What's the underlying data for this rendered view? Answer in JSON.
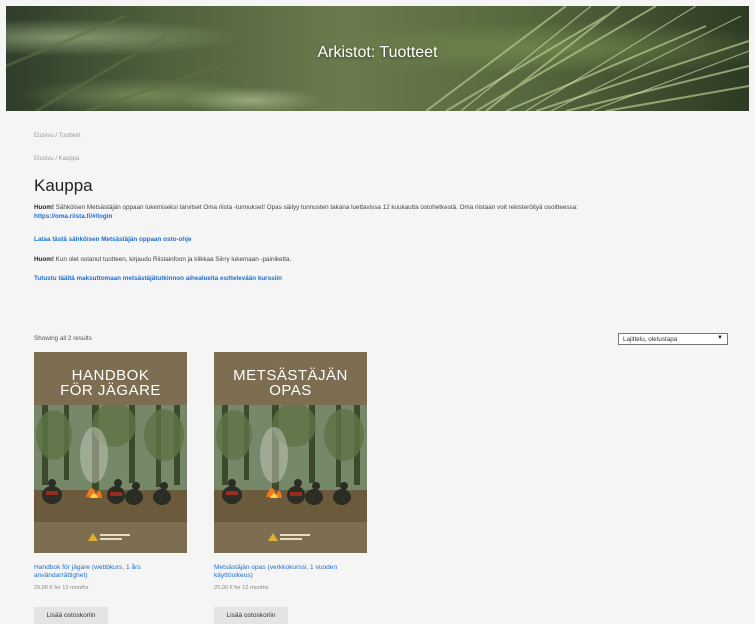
{
  "hero": {
    "title": "Arkistot: Tuotteet"
  },
  "breadcrumbs": {
    "primary": "Etusivu / Tuotteet",
    "secondary": "Etusivu / Kauppa"
  },
  "page": {
    "title": "Kauppa",
    "notice1_bold": "Huom!",
    "notice1_text": " Sähköisen Metsästäjän oppaan lukemiseksi tarvitset Oma riista -tunnukset! Opas säilyy tunnusten takana luettavissa 12 kuukautta ostohetkestä. Oma riistaan voit rekisteröityä osoitteessa: ",
    "notice1_link": "https://oma.riista.fi/#/login",
    "link1": "Lataa tästä sähköisen Metsästäjän oppaan osto-ohje",
    "notice2_bold": "Huom!",
    "notice2_text": " Kun olet ostanut tuotteen, kirjaudu Riistainfoon ja klikkaa Siirry lukemaan -painiketta.",
    "link2": "Tutustu täältä maksuttomaan metsästäjätutkinnon aihealueita esittelevään kurssiin"
  },
  "shop": {
    "results_text": "Showing all 2 results",
    "sort_value": "Lajittelu, oletustapa",
    "add_label": "Lisää ostoskoriin",
    "products": [
      {
        "cover_line1": "HANDBOK",
        "cover_line2": "FÖR JÄGARE",
        "name": "Handbok för jägare (webbkurs, 1 års användarrättighet)",
        "price": "25,00 € for 12 months"
      },
      {
        "cover_line1": "METSÄSTÄJÄN",
        "cover_line2": "OPAS",
        "name": "Metsästäjän opas (verkkokurssi, 1 vuoden käyttöoikeus)",
        "price": "25,00 € for 12 months"
      }
    ]
  },
  "colors": {
    "link": "#1e6fd0",
    "cover_bg": "#7d6e52",
    "button_bg": "#e4e4e4"
  }
}
